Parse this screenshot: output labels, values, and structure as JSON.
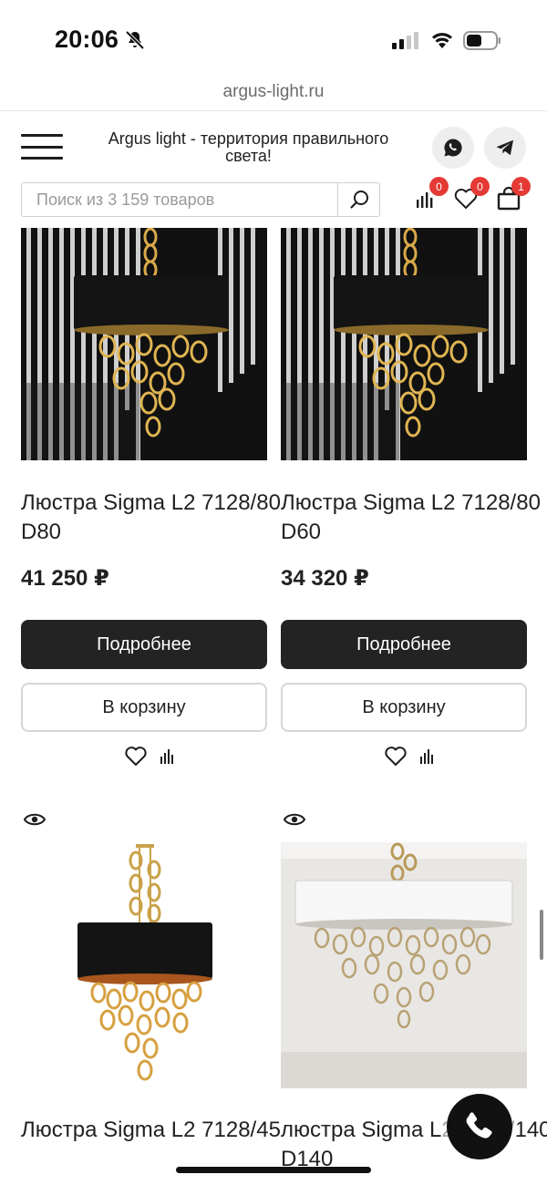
{
  "status_bar": {
    "time": "20:06"
  },
  "browser": {
    "url": "argus-light.ru"
  },
  "header": {
    "tagline": "Argus light - территория правильного света!",
    "search_placeholder": "Поиск из 3 159 товаров",
    "compare_count": "0",
    "favorites_count": "0",
    "cart_count": "1"
  },
  "products": [
    {
      "title": "Люстра Sigma L2 7128/80 D80",
      "price": "41 250 ₽",
      "details_label": "Подробнее",
      "cart_label": "В корзину"
    },
    {
      "title": "Люстра Sigma L2 7128/80 D60",
      "price": "34 320 ₽",
      "details_label": "Подробнее",
      "cart_label": "В корзину"
    },
    {
      "title": "Люстра Sigma L2 7128/45"
    },
    {
      "title": "люстра Sigma L2 7128/140 D140"
    }
  ],
  "colors": {
    "primary_button": "#232323",
    "badge": "#e53935",
    "accent_gold": "#c9a24a"
  }
}
